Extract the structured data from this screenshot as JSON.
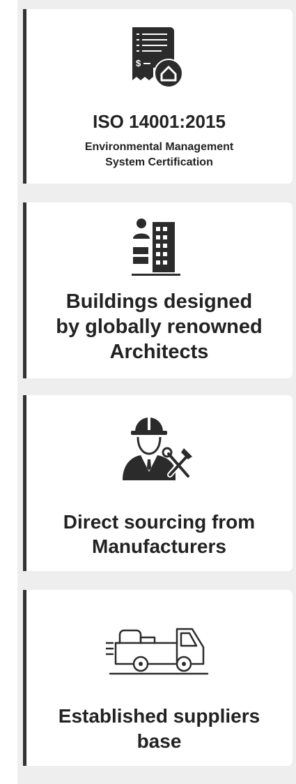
{
  "cards": [
    {
      "icon": "certificate-house-icon",
      "title": "ISO 14001:2015",
      "subtitle_line1": "Environmental Management",
      "subtitle_line2": "System Certification"
    },
    {
      "icon": "architect-building-icon",
      "title_line1": "Buildings designed",
      "title_line2": "by globally renowned",
      "title_line3": "Architects"
    },
    {
      "icon": "engineer-tools-icon",
      "title_line1": "Direct sourcing from",
      "title_line2": "Manufacturers"
    },
    {
      "icon": "delivery-truck-icon",
      "title_line1": "Established suppliers",
      "title_line2": "base"
    }
  ],
  "colors": {
    "accent_bar": "#333333",
    "text": "#222222",
    "icon": "#2b2b2b",
    "background_strip": "#eeeeee"
  }
}
